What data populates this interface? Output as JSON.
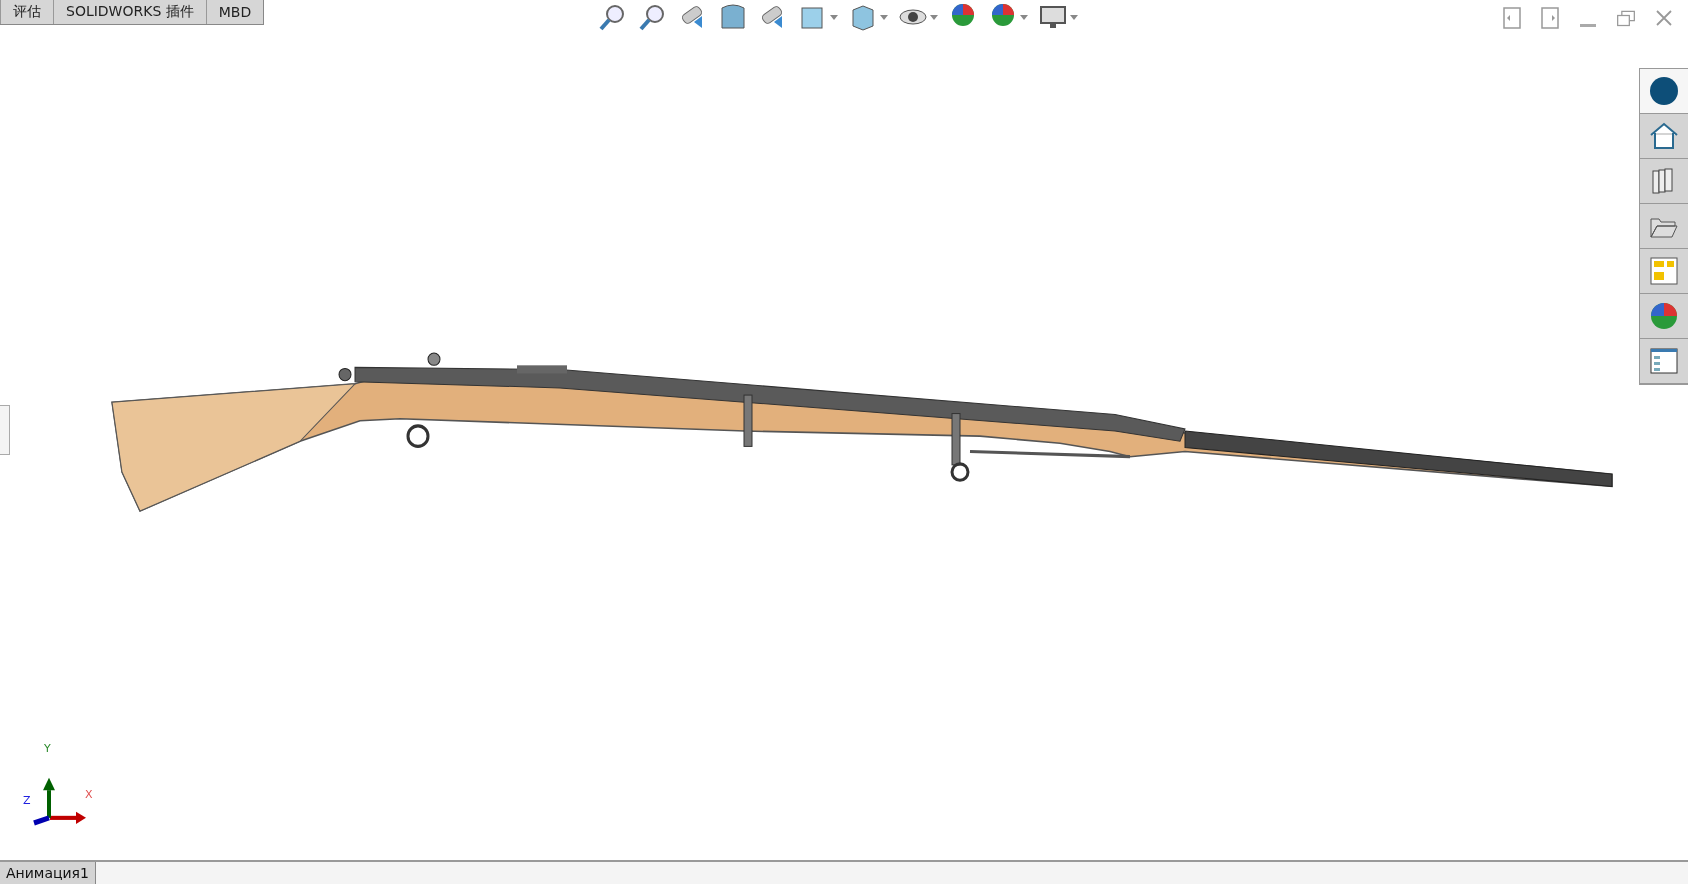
{
  "tabs": [
    {
      "label": "评估"
    },
    {
      "label": "SOLIDWORKS 插件"
    },
    {
      "label": "MBD"
    }
  ],
  "toolbar": [
    {
      "dropdown": false
    },
    {
      "dropdown": false
    },
    {
      "dropdown": false
    },
    {
      "dropdown": false
    },
    {
      "dropdown": false
    },
    {
      "dropdown": true
    },
    {
      "dropdown": true
    },
    {
      "dropdown": true
    },
    {
      "dropdown": false
    },
    {
      "dropdown": true
    },
    {
      "dropdown": true
    }
  ],
  "task_pane": [
    {
      "selected": true
    },
    {
      "selected": false
    },
    {
      "selected": false
    },
    {
      "selected": false
    },
    {
      "selected": false
    },
    {
      "selected": false
    },
    {
      "selected": false
    }
  ],
  "triad": {
    "x": "X",
    "y": "Y",
    "z": "Z"
  },
  "status_bar": {
    "tabs": [
      {
        "label": "Анимация1",
        "selected": true
      }
    ]
  }
}
